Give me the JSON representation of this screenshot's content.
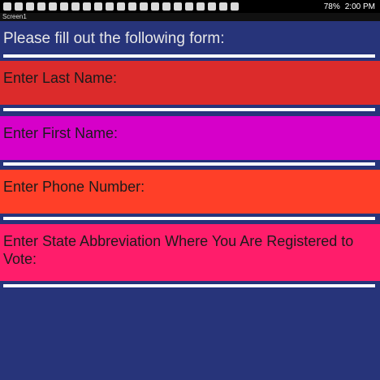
{
  "status_bar": {
    "battery": "78%",
    "time": "2:00 PM",
    "icons": [
      "notification-icon",
      "notification-icon",
      "notification-icon",
      "download-icon",
      "download-icon",
      "download-icon",
      "download-icon",
      "download-icon",
      "download-icon",
      "download-icon",
      "download-icon",
      "image-icon",
      "email-icon",
      "email-icon",
      "email-icon",
      "app-icon",
      "app-icon",
      "flag-icon",
      "flag-icon",
      "warning-icon",
      "warning-icon"
    ]
  },
  "window": {
    "title": "Screen1"
  },
  "form": {
    "heading": "Please fill out the following form:",
    "fields": [
      {
        "label": "Enter Last Name:",
        "value": ""
      },
      {
        "label": "Enter First Name:",
        "value": ""
      },
      {
        "label": "Enter Phone Number:",
        "value": ""
      },
      {
        "label": "Enter State Abbreviation Where You Are Registered to Vote:",
        "value": ""
      }
    ]
  },
  "colors": {
    "background": "#27347a",
    "panel_last_name": "#dc2b2b",
    "panel_first_name": "#d600c9",
    "panel_phone": "#ff3f28",
    "panel_state": "#ff1d6b"
  }
}
